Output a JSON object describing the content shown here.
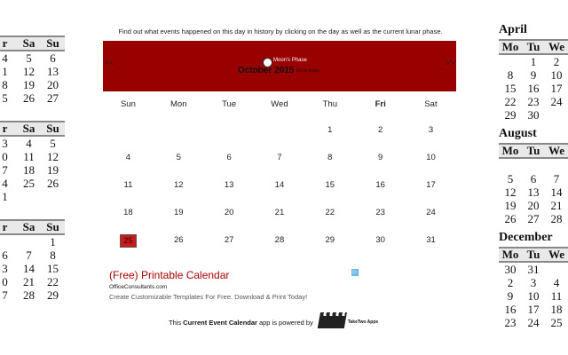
{
  "intro": "Find out what events happened on this day in history by clicking on the day as well as the current lunar phase.",
  "header": {
    "prev": "<<",
    "next": ">>",
    "moon_label": "Moon's Phase",
    "month_title": "October 2015",
    "go_today": "Go to today"
  },
  "weekdays": [
    "Sun",
    "Mon",
    "Tue",
    "Wed",
    "Thu",
    "Fri",
    "Sat"
  ],
  "weeks": [
    [
      "",
      "",
      "",
      "",
      "1",
      "2",
      "3"
    ],
    [
      "4",
      "5",
      "6",
      "7",
      "8",
      "9",
      "10"
    ],
    [
      "11",
      "12",
      "13",
      "14",
      "15",
      "16",
      "17"
    ],
    [
      "18",
      "19",
      "20",
      "21",
      "22",
      "23",
      "24"
    ],
    [
      "25",
      "26",
      "27",
      "28",
      "29",
      "30",
      "31"
    ]
  ],
  "today": "25",
  "accent": "#990000",
  "ad": {
    "title": "(Free) Printable Calendar",
    "url": "OfficeConsultants.com",
    "desc": "Create Customizable Templates For Free. Download & Print Today!",
    "info": "▷"
  },
  "footer": {
    "pre": "This",
    "app": "Current Event Calendar",
    "post": "app is powered by",
    "logo": "TakeTwo Apps"
  },
  "left_cals": [
    {
      "hdr": [
        "r",
        "Sa",
        "Su"
      ],
      "rows": [
        [
          "4",
          "5",
          "6"
        ],
        [
          "1",
          "12",
          "13"
        ],
        [
          "8",
          "19",
          "20"
        ],
        [
          "5",
          "26",
          "27"
        ]
      ]
    },
    {
      "hdr": [
        "r",
        "Sa",
        "Su"
      ],
      "rows": [
        [
          "3",
          "4",
          "5"
        ],
        [
          "0",
          "11",
          "12"
        ],
        [
          "7",
          "18",
          "19"
        ],
        [
          "4",
          "25",
          "26"
        ],
        [
          "1",
          "",
          ""
        ]
      ]
    },
    {
      "hdr": [
        "r",
        "Sa",
        "Su"
      ],
      "rows": [
        [
          "",
          "",
          "1"
        ],
        [
          "6",
          "7",
          "8"
        ],
        [
          "3",
          "14",
          "15"
        ],
        [
          "0",
          "21",
          "22"
        ],
        [
          "7",
          "28",
          "29"
        ]
      ]
    }
  ],
  "right_cals": [
    {
      "month": "April",
      "hdr": [
        "Mo",
        "Tu",
        "We"
      ],
      "rows": [
        [
          "",
          "1",
          "2"
        ],
        [
          "8",
          "9",
          "10"
        ],
        [
          "15",
          "16",
          "17"
        ],
        [
          "22",
          "23",
          "24"
        ],
        [
          "29",
          "30",
          ""
        ]
      ]
    },
    {
      "month": "August",
      "hdr": [
        "Mo",
        "Tu",
        "We"
      ],
      "rows": [
        [
          "",
          "",
          ""
        ],
        [
          "5",
          "6",
          "7"
        ],
        [
          "12",
          "13",
          "14"
        ],
        [
          "19",
          "20",
          "21"
        ],
        [
          "26",
          "27",
          "28"
        ]
      ]
    },
    {
      "month": "December",
      "hdr": [
        "Mo",
        "Tu",
        "We"
      ],
      "rows": [
        [
          "30",
          "31",
          ""
        ],
        [
          "2",
          "3",
          "4"
        ],
        [
          "9",
          "10",
          "11"
        ],
        [
          "16",
          "17",
          "18"
        ],
        [
          "23",
          "24",
          "25"
        ]
      ]
    }
  ]
}
